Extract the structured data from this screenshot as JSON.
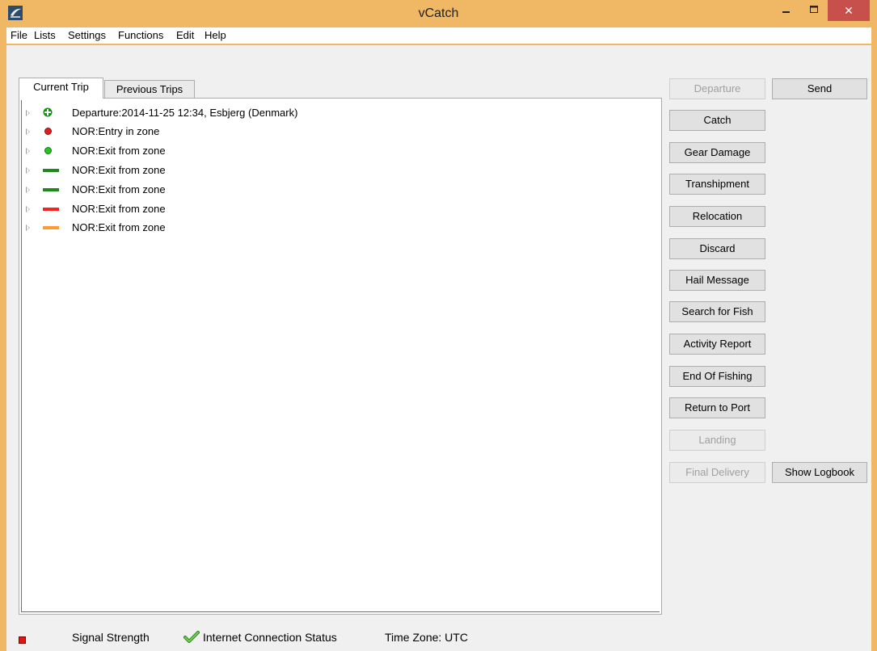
{
  "window": {
    "title": "vCatch",
    "minimize_icon": "minimize-icon",
    "maximize_icon": "maximize-icon",
    "close_icon": "close-icon",
    "close_symbol": "✕"
  },
  "menu": [
    "File",
    "Lists",
    "Settings",
    "Functions",
    "Edit",
    "Help"
  ],
  "tabs": {
    "current": "Current Trip",
    "previous": "Previous Trips"
  },
  "tree": [
    {
      "label": "Departure:2014-11-25 12:34,  Esbjerg (Denmark)",
      "icon": "plus-icon",
      "color": "#1a8c1a"
    },
    {
      "label": "NOR:Entry in zone",
      "icon": "red-dot-icon",
      "color": "#e51c1c"
    },
    {
      "label": "NOR:Exit from zone",
      "icon": "green-dot-icon",
      "color": "#22c61e"
    },
    {
      "label": "NOR:Exit from zone",
      "icon": "green-bar-icon",
      "color": "#1e8a1e"
    },
    {
      "label": "NOR:Exit from zone",
      "icon": "green-bar-icon",
      "color": "#1e8a1e"
    },
    {
      "label": "NOR:Exit from zone",
      "icon": "red-bar-icon",
      "color": "#ff1f1f"
    },
    {
      "label": "NOR:Exit from zone",
      "icon": "orange-bar-icon",
      "color": "#ff9a2e"
    }
  ],
  "buttons": {
    "departure": "Departure",
    "send": "Send",
    "catch": "Catch",
    "gear_damage": "Gear Damage",
    "transhipment": "Transhipment",
    "relocation": "Relocation",
    "discard": "Discard",
    "hail_message": "Hail Message",
    "search_for_fish": "Search for Fish",
    "activity_report": "Activity Report",
    "end_of_fishing": "End Of Fishing",
    "return_to_port": "Return to Port",
    "landing": "Landing",
    "final_delivery": "Final Delivery",
    "show_logbook": "Show Logbook"
  },
  "status": {
    "signal_strength": "Signal Strength",
    "internet_connection": "Internet Connection Status",
    "time_zone": "Time Zone: UTC",
    "signal_color": "#e21515",
    "check_color": "#4caf2f"
  }
}
